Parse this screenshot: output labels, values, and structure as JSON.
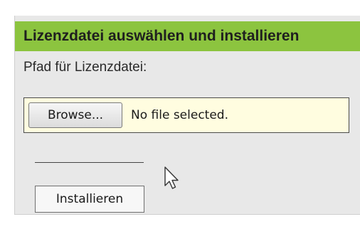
{
  "panel": {
    "header_title": "Lizenzdatei auswählen und installieren",
    "path_label": "Pfad für Lizenzdatei:",
    "file_input": {
      "browse_label": "Browse...",
      "status_text": "No file selected."
    },
    "install_label": "Installieren"
  },
  "colors": {
    "header_bg": "#8cc43f",
    "panel_bg": "#e8e8e8",
    "file_field_bg": "#fffde0"
  },
  "icons": {
    "cursor": "mouse-pointer-icon"
  }
}
